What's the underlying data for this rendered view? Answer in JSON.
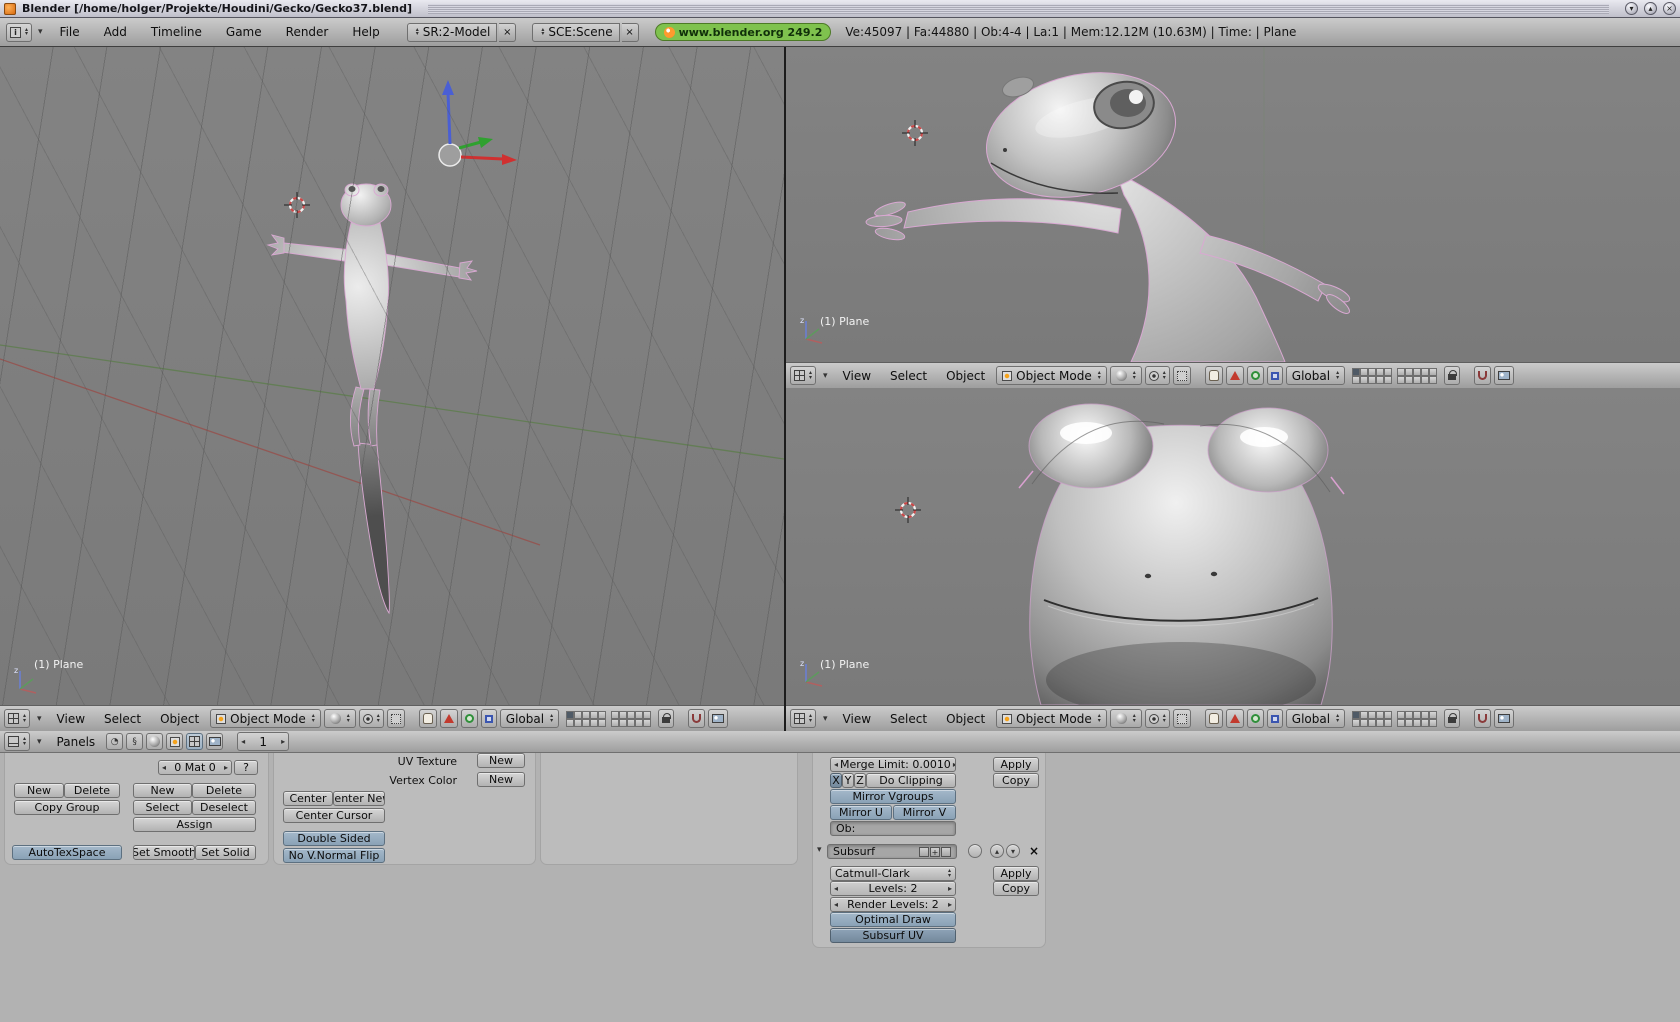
{
  "colors": {
    "header-top": "#cbcbcb",
    "header-bottom": "#9e9e9e",
    "viewport-bg": "#7e7e7e",
    "buttons-bg": "#b2b2b2",
    "panel-bg": "#bcbcbc",
    "badge-bg": "#7fc24e",
    "pressed": "#8fa8bf"
  },
  "titlebar": {
    "title": "Blender [/home/holger/Projekte/Houdini/Gecko/Gecko37.blend]"
  },
  "menubar": {
    "menus": [
      "File",
      "Add",
      "Timeline",
      "Game",
      "Render",
      "Help"
    ],
    "screen": "SR:2-Model",
    "scene": "SCE:Scene",
    "badge": "www.blender.org 249.2",
    "stats": "Ve:45097 | Fa:44880 | Ob:4-4 | La:1  | Mem:12.12M (10.63M)  | Time: | Plane"
  },
  "viewport": {
    "label": "(1) Plane",
    "menus": [
      "View",
      "Select",
      "Object"
    ],
    "mode": "Object Mode",
    "orientation": "Global"
  },
  "buttons_header": {
    "panels_label": "Panels",
    "page": "1"
  },
  "link_materials": {
    "mat_field": "0 Mat 0",
    "help": "?",
    "new": "New",
    "delete": "Delete",
    "copy_group": "Copy Group",
    "vg_new": "New",
    "vg_delete": "Delete",
    "select": "Select",
    "deselect": "Deselect",
    "assign": "Assign",
    "autotexspace": "AutoTexSpace",
    "set_smooth": "Set Smooth",
    "set_solid": "Set Solid"
  },
  "mesh_panel": {
    "uv_texture": "UV Texture",
    "uv_new": "New",
    "vertex_color": "Vertex Color",
    "vc_new": "New",
    "center": "Center",
    "center_new": "Center New",
    "center_cursor": "Center Cursor",
    "double_sided": "Double Sided",
    "no_vnormal_flip": "No V.Normal Flip"
  },
  "modifiers": {
    "mirror": {
      "merge_limit": "Merge Limit: 0.0010",
      "axis_x": "X",
      "axis_y": "Y",
      "axis_z": "Z",
      "do_clipping": "Do Clipping",
      "mirror_vgroups": "Mirror Vgroups",
      "mirror_u": "Mirror U",
      "mirror_v": "Mirror V",
      "ob_field": "Ob:",
      "apply": "Apply",
      "copy": "Copy"
    },
    "subsurf": {
      "name": "Subsurf",
      "type": "Catmull-Clark",
      "levels": "Levels: 2",
      "render_levels": "Render Levels: 2",
      "optimal_draw": "Optimal Draw",
      "subsurf_uv": "Subsurf UV",
      "apply": "Apply",
      "copy": "Copy"
    }
  }
}
